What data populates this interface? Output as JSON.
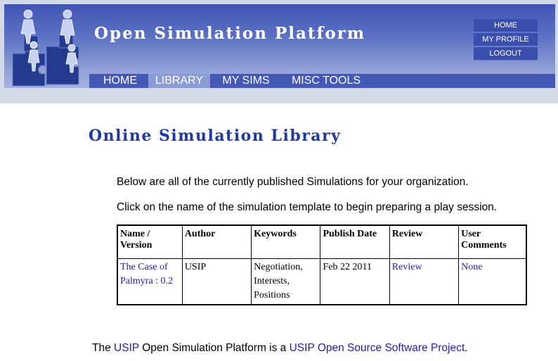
{
  "header": {
    "site_title": "Open Simulation Platform",
    "user_menu": [
      "HOME",
      "MY PROFILE",
      "LOGOUT"
    ],
    "nav": [
      "HOME",
      "LIBRARY",
      "MY SIMS",
      "MISC TOOLS"
    ],
    "active_nav": "LIBRARY"
  },
  "main": {
    "heading": "Online Simulation Library",
    "intro_line_1": "Below are all of the currently published Simulations for your organization.",
    "intro_line_2": "Click on the name of the simulation template to begin preparing a play session.",
    "table": {
      "headers": [
        "Name / Version",
        "Author",
        "Keywords",
        "Publish Date",
        "Review",
        "User Comments"
      ],
      "rows": [
        {
          "name": "The Case of Palmyra : 0.2",
          "author": "USIP",
          "keywords": "Negotiation, Interests, Positions",
          "publish_date": "Feb 22 2011",
          "review": "Review",
          "comments": "None"
        }
      ]
    }
  },
  "footer": {
    "prefix": "The",
    "link1": "USIP",
    "middle": "Open Simulation Platform is a",
    "link2": "USIP Open Source Software Project",
    "suffix": "."
  },
  "colors": {
    "banner": "#4a5fb8",
    "heading": "#1d3aa0",
    "link": "#2a1aa8",
    "nav_active": "#8a9bd6"
  }
}
